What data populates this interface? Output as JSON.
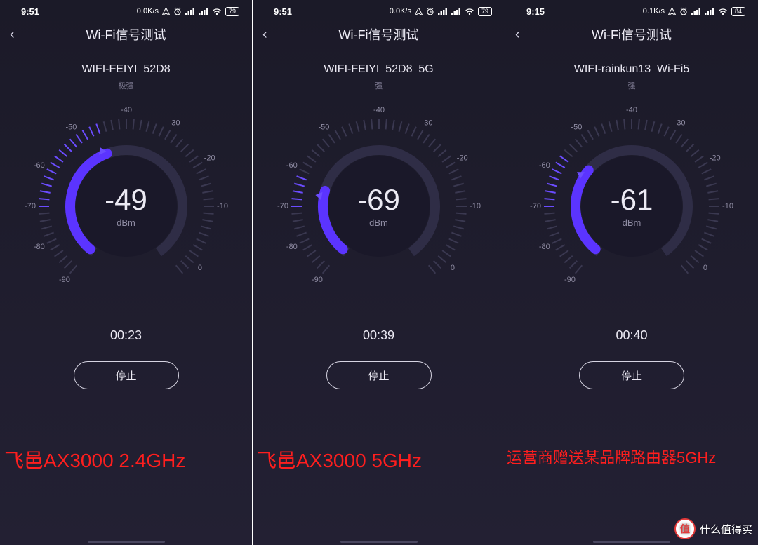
{
  "watermark": {
    "badge": "值",
    "text": "什么值得买"
  },
  "gauge": {
    "unit": "dBm",
    "labels": [
      "-40",
      "-30",
      "-20",
      "-10",
      "0",
      "-50",
      "-60",
      "-70",
      "-80",
      "-90"
    ],
    "min": -90,
    "max": 0
  },
  "panels": [
    {
      "status": {
        "time": "9:51",
        "speed": "0.0K/s",
        "battery": "79"
      },
      "nav": {
        "title": "Wi-Fi信号测试"
      },
      "ssid": "WIFI-FEIYI_52D8",
      "strength": "极强",
      "dbm": "-49",
      "timer": "00:23",
      "stop": "停止",
      "caption": "飞邑AX3000 2.4GHz",
      "caption_size": "normal",
      "needle_deg": -114,
      "arc_start": -230,
      "arc_end": -110,
      "tick_lit_start": 180,
      "tick_lit_end": 250
    },
    {
      "status": {
        "time": "9:51",
        "speed": "0.0K/s",
        "battery": "79"
      },
      "nav": {
        "title": "Wi-Fi信号测试"
      },
      "ssid": "WIFI-FEIYI_52D8_5G",
      "strength": "强",
      "dbm": "-69",
      "timer": "00:39",
      "stop": "停止",
      "caption": "飞邑AX3000 5GHz",
      "caption_size": "normal",
      "needle_deg": -170,
      "arc_start": -230,
      "arc_end": -164,
      "tick_lit_start": 180,
      "tick_lit_end": 200
    },
    {
      "status": {
        "time": "9:15",
        "speed": "0.1K/s",
        "battery": "84"
      },
      "nav": {
        "title": "Wi-Fi信号测试"
      },
      "ssid": "WIFI-rainkun13_Wi-Fi5",
      "strength": "强",
      "dbm": "-61",
      "timer": "00:40",
      "stop": "停止",
      "caption": "运营商赠送某品牌路由器5GHz",
      "caption_size": "small",
      "needle_deg": -148,
      "arc_start": -230,
      "arc_end": -140,
      "tick_lit_start": 180,
      "tick_lit_end": 218
    }
  ]
}
